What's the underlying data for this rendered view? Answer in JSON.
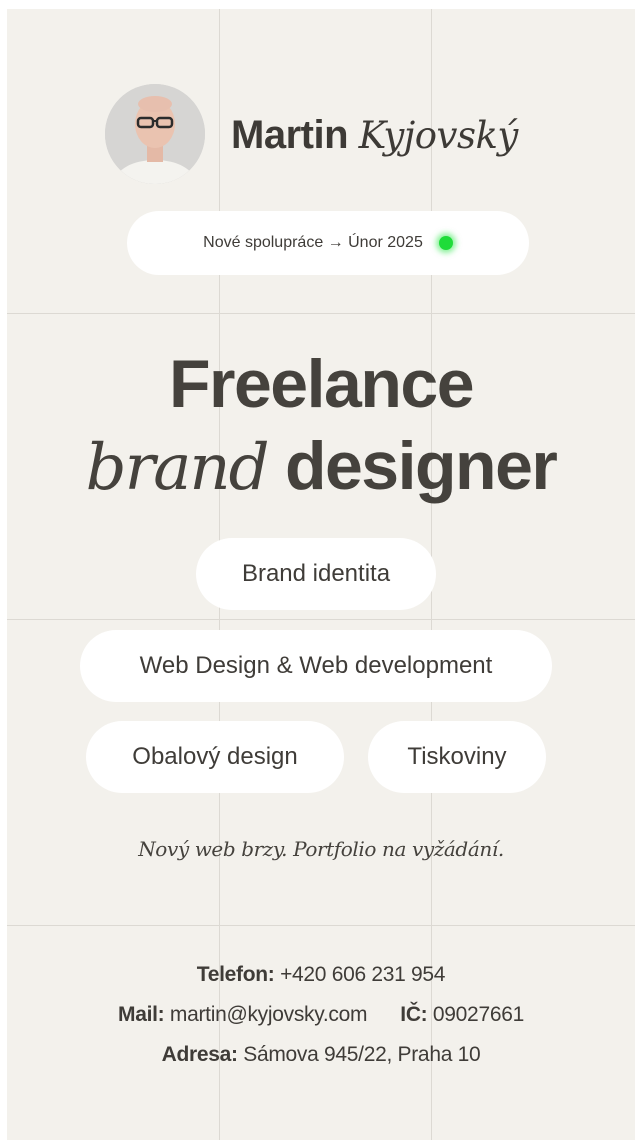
{
  "profile": {
    "first_name": "Martin",
    "last_name": "Kyjovský"
  },
  "status": {
    "text": "Nové spolupráce → Únor 2025",
    "indicator_color": "#1fdc39"
  },
  "hero": {
    "line1": "Freelance",
    "line2_italic": "brand",
    "line2_bold": "designer"
  },
  "services": [
    "Brand identita",
    "Web Design & Web development",
    "Obalový design",
    "Tiskoviny"
  ],
  "note": "Nový web brzy. Portfolio na vyžádání.",
  "contact": {
    "phone_label": "Telefon:",
    "phone_value": "+420 606 231 954",
    "mail_label": "Mail:",
    "mail_value": "martin@kyjovsky.com",
    "ic_label": "IČ:",
    "ic_value": "09027661",
    "address_label": "Adresa:",
    "address_value": "Sámova 945/22, Praha 10"
  },
  "colors": {
    "background": "#f3f1ec",
    "pill": "#ffffff",
    "text": "#3f3c38",
    "grid": "#dcd9d3"
  }
}
